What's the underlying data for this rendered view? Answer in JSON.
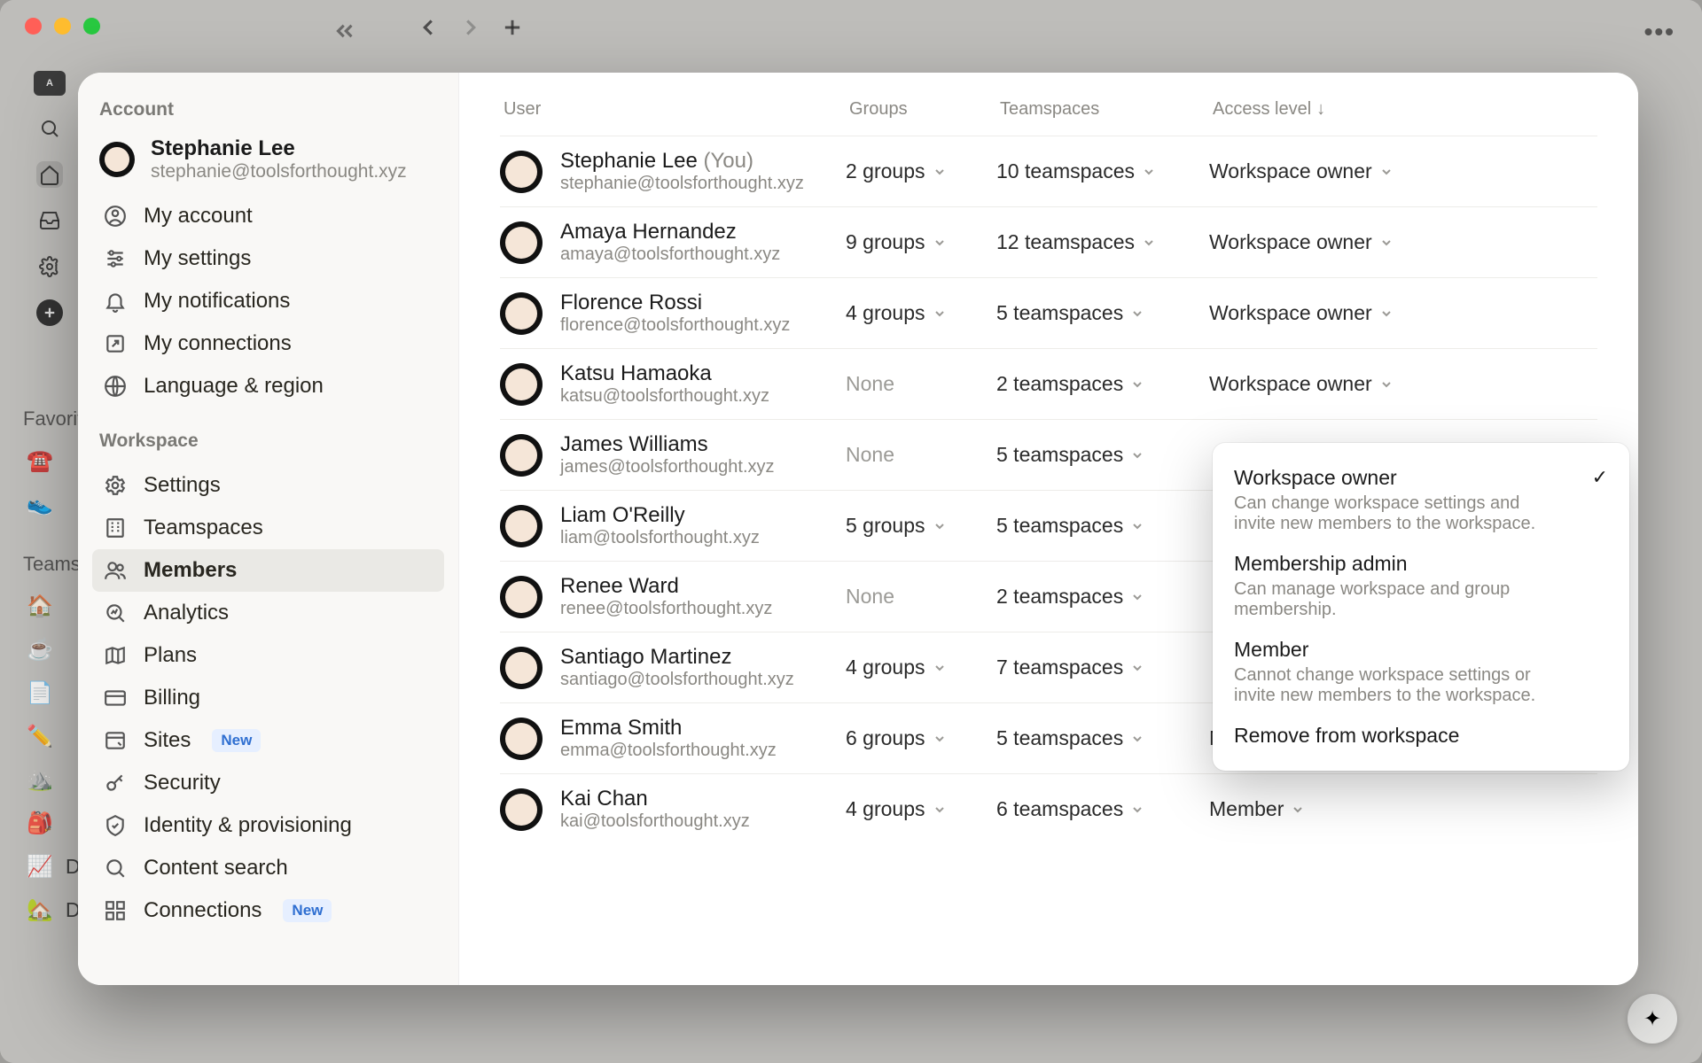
{
  "sidebar": {
    "section_account": "Account",
    "section_workspace": "Workspace",
    "profile": {
      "name": "Stephanie Lee",
      "email": "stephanie@toolsforthought.xyz"
    },
    "account_items": [
      {
        "label": "My account"
      },
      {
        "label": "My settings"
      },
      {
        "label": "My notifications"
      },
      {
        "label": "My connections"
      },
      {
        "label": "Language & region"
      }
    ],
    "workspace_items": [
      {
        "label": "Settings"
      },
      {
        "label": "Teamspaces"
      },
      {
        "label": "Members"
      },
      {
        "label": "Analytics"
      },
      {
        "label": "Plans"
      },
      {
        "label": "Billing"
      },
      {
        "label": "Sites",
        "badge": "New"
      },
      {
        "label": "Security"
      },
      {
        "label": "Identity & provisioning"
      },
      {
        "label": "Content search"
      },
      {
        "label": "Connections",
        "badge": "New"
      }
    ]
  },
  "columns": {
    "user": "User",
    "groups": "Groups",
    "teamspaces": "Teamspaces",
    "access": "Access level"
  },
  "members": [
    {
      "name": "Stephanie Lee",
      "you": "(You)",
      "email": "stephanie@toolsforthought.xyz",
      "groups": "2 groups",
      "teamspaces": "10 teamspaces",
      "access": "Workspace owner"
    },
    {
      "name": "Amaya Hernandez",
      "email": "amaya@toolsforthought.xyz",
      "groups": "9 groups",
      "teamspaces": "12 teamspaces",
      "access": "Workspace owner"
    },
    {
      "name": "Florence Rossi",
      "email": "florence@toolsforthought.xyz",
      "groups": "4 groups",
      "teamspaces": "5 teamspaces",
      "access": "Workspace owner"
    },
    {
      "name": "Katsu Hamaoka",
      "email": "katsu@toolsforthought.xyz",
      "groups": "None",
      "groups_none": true,
      "teamspaces": "2 teamspaces",
      "access": "Workspace owner"
    },
    {
      "name": "James Williams",
      "email": "james@toolsforthought.xyz",
      "groups": "None",
      "groups_none": true,
      "teamspaces": "5 teamspaces",
      "access": ""
    },
    {
      "name": "Liam O'Reilly",
      "email": "liam@toolsforthought.xyz",
      "groups": "5 groups",
      "teamspaces": "5 teamspaces",
      "access": ""
    },
    {
      "name": "Renee Ward",
      "email": "renee@toolsforthought.xyz",
      "groups": "None",
      "groups_none": true,
      "teamspaces": "2 teamspaces",
      "access": ""
    },
    {
      "name": "Santiago Martinez",
      "email": "santiago@toolsforthought.xyz",
      "groups": "4 groups",
      "teamspaces": "7 teamspaces",
      "access": ""
    },
    {
      "name": "Emma Smith",
      "email": "emma@toolsforthought.xyz",
      "groups": "6 groups",
      "teamspaces": "5 teamspaces",
      "access": "Member"
    },
    {
      "name": "Kai Chan",
      "email": "kai@toolsforthought.xyz",
      "groups": "4 groups",
      "teamspaces": "6 teamspaces",
      "access": "Member"
    }
  ],
  "dropdown": {
    "items": [
      {
        "title": "Workspace owner",
        "desc": "Can change workspace settings and invite new members to the workspace.",
        "checked": true
      },
      {
        "title": "Membership admin",
        "desc": "Can manage workspace and group membership."
      },
      {
        "title": "Member",
        "desc": "Cannot change workspace settings or invite new members to the workspace."
      },
      {
        "title": "Remove from workspace"
      }
    ]
  },
  "left_rail": {
    "favorites": "Favorites",
    "teamspaces": "Teamspaces",
    "data": "Data",
    "data_home": "Data Home"
  }
}
